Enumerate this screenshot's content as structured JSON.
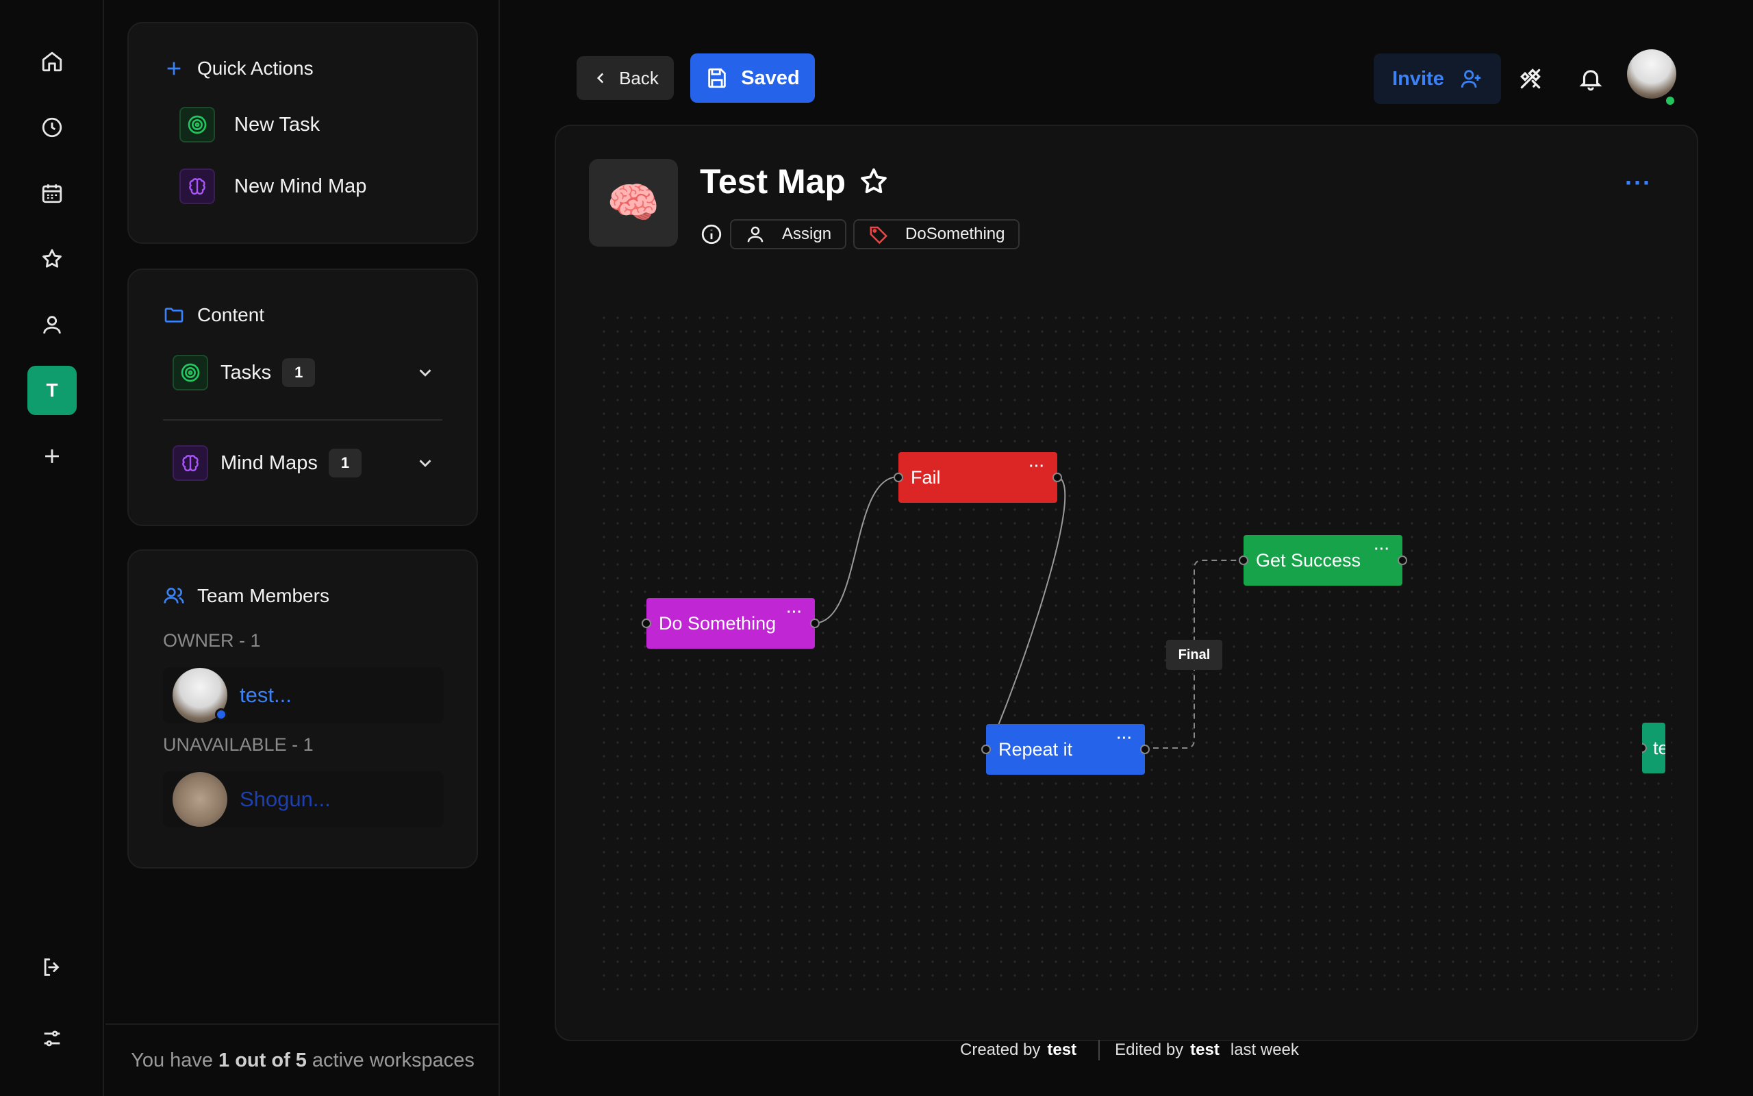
{
  "rail": {
    "workspace_initial": "T"
  },
  "sidebar": {
    "quick_actions": {
      "title": "Quick Actions",
      "items": [
        {
          "label": "New Task",
          "icon": "target-icon"
        },
        {
          "label": "New Mind Map",
          "icon": "brain-icon"
        }
      ]
    },
    "content": {
      "title": "Content",
      "sections": [
        {
          "label": "Tasks",
          "count": "1",
          "icon": "target-icon"
        },
        {
          "label": "Mind Maps",
          "count": "1",
          "icon": "brain-icon"
        }
      ]
    },
    "team": {
      "title": "Team Members",
      "owner_label": "OWNER - 1",
      "owner_name": "test...",
      "unavailable_label": "UNAVAILABLE - 1",
      "unavailable_name": "Shogun..."
    },
    "workspaces": {
      "prefix": "You have",
      "count": "1 out of 5",
      "suffix": "active workspaces"
    }
  },
  "header": {
    "back_label": "Back",
    "saved_label": "Saved",
    "invite_label": "Invite"
  },
  "map": {
    "title": "Test Map",
    "assign_label": "Assign",
    "tag_label": "DoSomething",
    "more_label": "···",
    "nodes": {
      "do_something": "Do Something",
      "fail": "Fail",
      "get_success": "Get Success",
      "repeat_it": "Repeat it",
      "partial": "te"
    },
    "node_menu": "···",
    "edge_label": "Final"
  },
  "footer": {
    "created_prefix": "Created by",
    "created_by": "test",
    "edited_prefix": "Edited by",
    "edited_by": "test",
    "edited_when": "last week"
  },
  "colors": {
    "accent": "#2563eb",
    "node_purple": "#c026d3",
    "node_red": "#dc2626",
    "node_green": "#16a34a",
    "node_blue": "#2563eb",
    "active_workspace": "#0f9d6e"
  }
}
